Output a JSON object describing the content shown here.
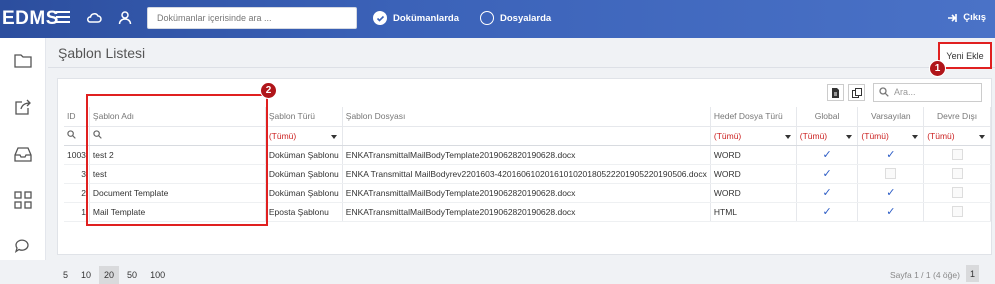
{
  "app": {
    "logo": "EDMS"
  },
  "topbar": {
    "search_placeholder": "Dokümanlar içerisinde ara ...",
    "radio_documents": "Dokümanlarda",
    "radio_folders": "Dosyalarda",
    "logout": "Çıkış"
  },
  "page": {
    "title": "Şablon Listesi",
    "add_button": "Yeni Ekle",
    "badge1": "1",
    "badge2": "2",
    "grid_search_placeholder": "Ara..."
  },
  "table": {
    "columns": [
      "ID",
      "Şablon Adı",
      "Şablon Türü",
      "Şablon Dosyası",
      "Hedef Dosya Türü",
      "Global",
      "Varsayılan",
      "Devre Dışı"
    ],
    "filter_all": "(Tümü)",
    "rows": [
      {
        "id": "1003",
        "name": "test 2",
        "type": "Doküman Şablonu",
        "file": "ENKATransmittalMailBodyTemplate2019062820190628.docx",
        "target": "WORD",
        "global": true,
        "default": true
      },
      {
        "id": "3",
        "name": "test",
        "type": "Doküman Şablonu",
        "file": "ENKA Transmittal MailBodyrev2201603-4201606102016101020180522201905220190506.docx",
        "target": "WORD",
        "global": true,
        "default": false
      },
      {
        "id": "2",
        "name": "Document Template",
        "type": "Doküman Şablonu",
        "file": "ENKATransmittalMailBodyTemplate2019062820190628.docx",
        "target": "WORD",
        "global": true,
        "default": true
      },
      {
        "id": "1",
        "name": "Mail Template",
        "type": "Eposta Şablonu",
        "file": "ENKATransmittalMailBodyTemplate2019062820190628.docx",
        "target": "HTML",
        "global": true,
        "default": true
      }
    ]
  },
  "pager": {
    "sizes": [
      "5",
      "10",
      "20",
      "50",
      "100"
    ],
    "active_size": "20",
    "info": "Sayfa 1 / 1 (4 öğe)",
    "current_page": "1"
  }
}
